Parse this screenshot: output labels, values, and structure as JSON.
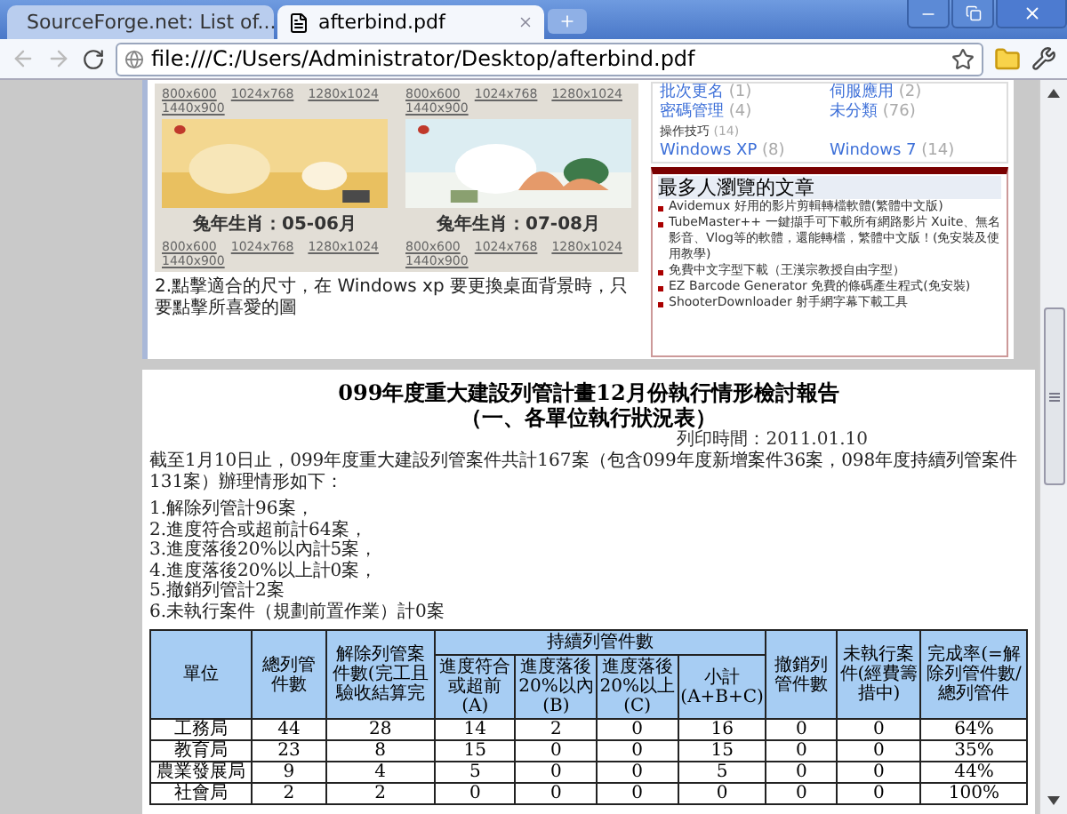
{
  "browser": {
    "tabs": [
      {
        "title": "SourceForge.net: List of...",
        "selected": false,
        "kind": "site"
      },
      {
        "title": "afterbind.pdf",
        "selected": true,
        "kind": "document"
      }
    ],
    "address": "file:///C:/Users/Administrator/Desktop/afterbind.pdf"
  },
  "page_1": {
    "link_rows_top": [
      [
        "800x600",
        "1024x768",
        "1280x1024",
        "1440x900"
      ],
      [
        "800x600",
        "1024x768",
        "1280x1024",
        "1440x900"
      ]
    ],
    "wallpapers": [
      {
        "caption": "兔年生肖：05-06月",
        "links": [
          "800x600",
          "1024x768",
          "1280x1024",
          "1440x900"
        ],
        "kind": "warm"
      },
      {
        "caption": "兔年生肖：07-08月",
        "links": [
          "800x600",
          "1024x768",
          "1280x1024",
          "1440x900"
        ],
        "kind": "sky"
      }
    ],
    "sentence": "2.點擊適合的尺寸，在 Windows xp 要更換桌面背景時，只要點擊所喜愛的圖",
    "categories": [
      {
        "name": "批次更名",
        "count": "(1)",
        "kind": "link"
      },
      {
        "name": "伺服應用",
        "count": "(2)",
        "kind": "link"
      },
      {
        "name": "密碼管理",
        "count": "(4)",
        "kind": "link"
      },
      {
        "name": "未分類",
        "count": "(76)",
        "kind": "link"
      },
      {
        "name": "操作技巧",
        "count": "(14)",
        "kind": "group"
      },
      {
        "name": "Windows XP",
        "count": "(8)",
        "kind": "link"
      },
      {
        "name": "Windows 7",
        "count": "(14)",
        "kind": "link"
      }
    ],
    "heading": "最多人瀏覽的文章",
    "articles": [
      "Avidemux 好用的影片剪輯轉檔軟體(繁體中文版)",
      "TubeMaster++ 一鍵擷手可下載所有網路影片 Xuite、無名影音、Vlog等的軟體，還能轉檔，繁體中文版！(免安裝及使用教學)",
      "免費中文字型下載（王漢宗教授自由字型）",
      "EZ Barcode Generator 免費的條碼產生程式(免安裝)",
      "ShooterDownloader 射手網字幕下載工具"
    ]
  },
  "page_2": {
    "title": "099年度重大建設列管計畫12月份執行情形檢討報告",
    "subtitle": "（一、各單位執行狀況表）",
    "print_time": "列印時間：2011.01.10",
    "intro": "截至1月10日止，099年度重大建設列管案件共計167案（包含099年度新增案件36案，098年度持續列管案件131案）辦理情形如下：",
    "items": [
      "1.解除列管計96案，",
      "2.進度符合或超前計64案，",
      "3.進度落後20%以內計5案，",
      "4.進度落後20%以上計0案，",
      "5.撤銷列管計2案",
      "6.未執行案件（規劃前置作業）計0案"
    ],
    "table": {
      "column_group": {
        "label": "持續列管件數"
      },
      "columns": [
        {
          "label": "單位",
          "grouped": false
        },
        {
          "label": "總列管件數",
          "grouped": false
        },
        {
          "label": "解除列管案件數(完工且驗收結算完",
          "grouped": false
        },
        {
          "label": "進度符合或超前(A)",
          "grouped": true
        },
        {
          "label": "進度落後20%以內(B)",
          "grouped": true
        },
        {
          "label": "進度落後20%以上(C)",
          "grouped": true
        },
        {
          "label": "小計(A+B+C)",
          "grouped": true
        },
        {
          "label": "撤銷列管件數",
          "grouped": false
        },
        {
          "label": "未執行案件(經費籌措中)",
          "grouped": false
        },
        {
          "label": "完成率(=解除列管件數/總列管件",
          "grouped": false
        }
      ],
      "rows": [
        [
          "工務局",
          "44",
          "28",
          "14",
          "2",
          "0",
          "16",
          "0",
          "0",
          "64%"
        ],
        [
          "教育局",
          "23",
          "8",
          "15",
          "0",
          "0",
          "15",
          "0",
          "0",
          "35%"
        ],
        [
          "農業發展局",
          "9",
          "4",
          "5",
          "0",
          "0",
          "5",
          "0",
          "0",
          "44%"
        ],
        [
          "社會局",
          "2",
          "2",
          "0",
          "0",
          "0",
          "0",
          "0",
          "0",
          "100%"
        ]
      ]
    }
  }
}
